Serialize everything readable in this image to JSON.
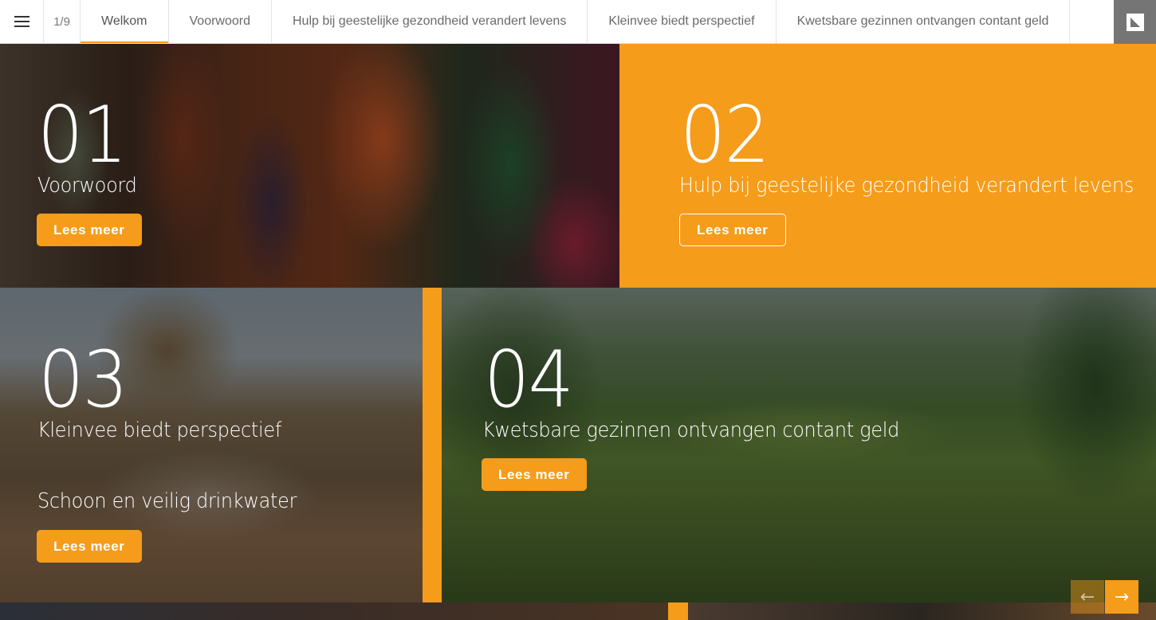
{
  "nav": {
    "page_counter": "1/9",
    "tabs": [
      {
        "label": "Welkom",
        "active": true
      },
      {
        "label": "Voorwoord"
      },
      {
        "label": "Hulp bij geestelijke gezondheid verandert levens"
      },
      {
        "label": "Kleinvee biedt perspectief"
      },
      {
        "label": "Kwetsbare gezinnen ontvangen contant geld"
      }
    ],
    "menu_icon": "hamburger-icon",
    "brand_icon": "corner-logo-icon"
  },
  "tiles": [
    {
      "number": "01",
      "title": "Voorwoord",
      "button": "Lees meer"
    },
    {
      "number": "02",
      "title": "Hulp bij geestelijke gezondheid verandert levens",
      "button": "Lees meer"
    },
    {
      "number": "03",
      "title": "Kleinvee biedt perspectief",
      "subtitle": "Schoon en veilig drinkwater",
      "button": "Lees meer"
    },
    {
      "number": "04",
      "title": "Kwetsbare gezinnen ontvangen contant geld",
      "button": "Lees meer"
    }
  ],
  "pager": {
    "prev_icon": "←",
    "next_icon": "→"
  },
  "colors": {
    "accent": "#f59c1a",
    "nav_bg": "#ffffff",
    "brand_bg": "#757575"
  }
}
